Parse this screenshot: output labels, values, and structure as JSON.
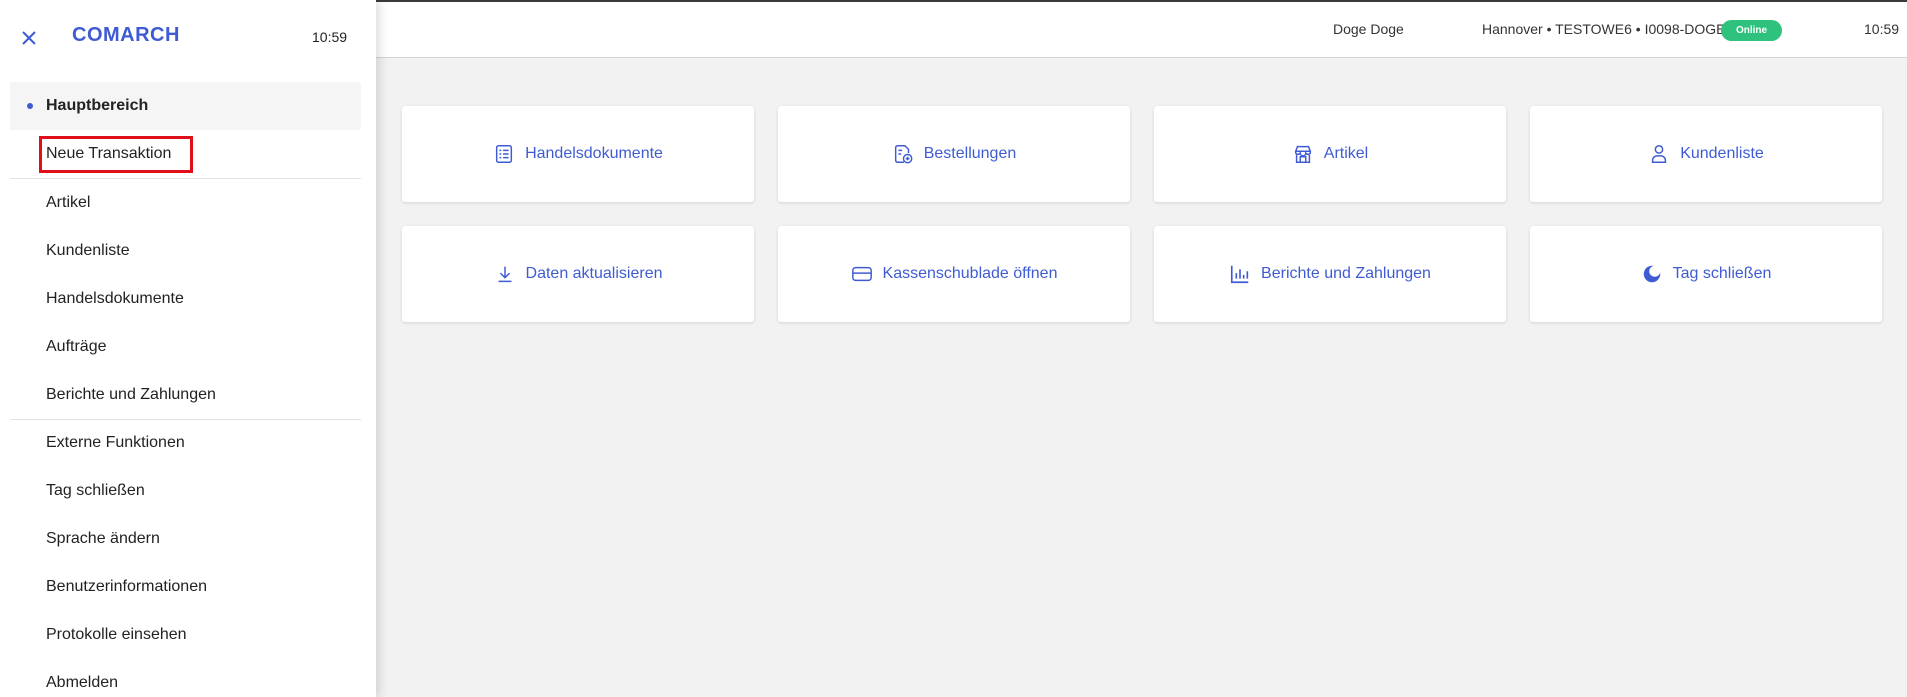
{
  "header": {
    "user": "Doge Doge",
    "location": "Hannover • TESTOWE6 • I0098-DOGE",
    "status": "Online",
    "time": "10:59"
  },
  "tiles": [
    {
      "label": "Handelsdokumente",
      "icon": "document-list-icon"
    },
    {
      "label": "Bestellungen",
      "icon": "order-add-icon"
    },
    {
      "label": "Artikel",
      "icon": "store-icon"
    },
    {
      "label": "Kundenliste",
      "icon": "user-icon"
    },
    {
      "label": "Daten aktualisieren",
      "icon": "download-icon"
    },
    {
      "label": "Kassenschublade öffnen",
      "icon": "card-icon"
    },
    {
      "label": "Berichte und Zahlungen",
      "icon": "bar-chart-icon"
    },
    {
      "label": "Tag schließen",
      "icon": "moon-icon"
    }
  ],
  "sidebar": {
    "logo": "COMARCH",
    "time": "10:59",
    "items": [
      {
        "label": "Hauptbereich"
      },
      {
        "label": "Neue Transaktion"
      },
      {
        "label": "Artikel"
      },
      {
        "label": "Kundenliste"
      },
      {
        "label": "Handelsdokumente"
      },
      {
        "label": "Aufträge"
      },
      {
        "label": "Berichte und Zahlungen"
      },
      {
        "label": "Externe Funktionen"
      },
      {
        "label": "Tag schließen"
      },
      {
        "label": "Sprache ändern"
      },
      {
        "label": "Benutzerinformationen"
      },
      {
        "label": "Protokolle einsehen"
      },
      {
        "label": "Abmelden"
      }
    ]
  },
  "colors": {
    "accent": "#3f5bd4",
    "online": "#2ec27e",
    "highlight": "#e0101a",
    "background": "#f2f2f2"
  }
}
